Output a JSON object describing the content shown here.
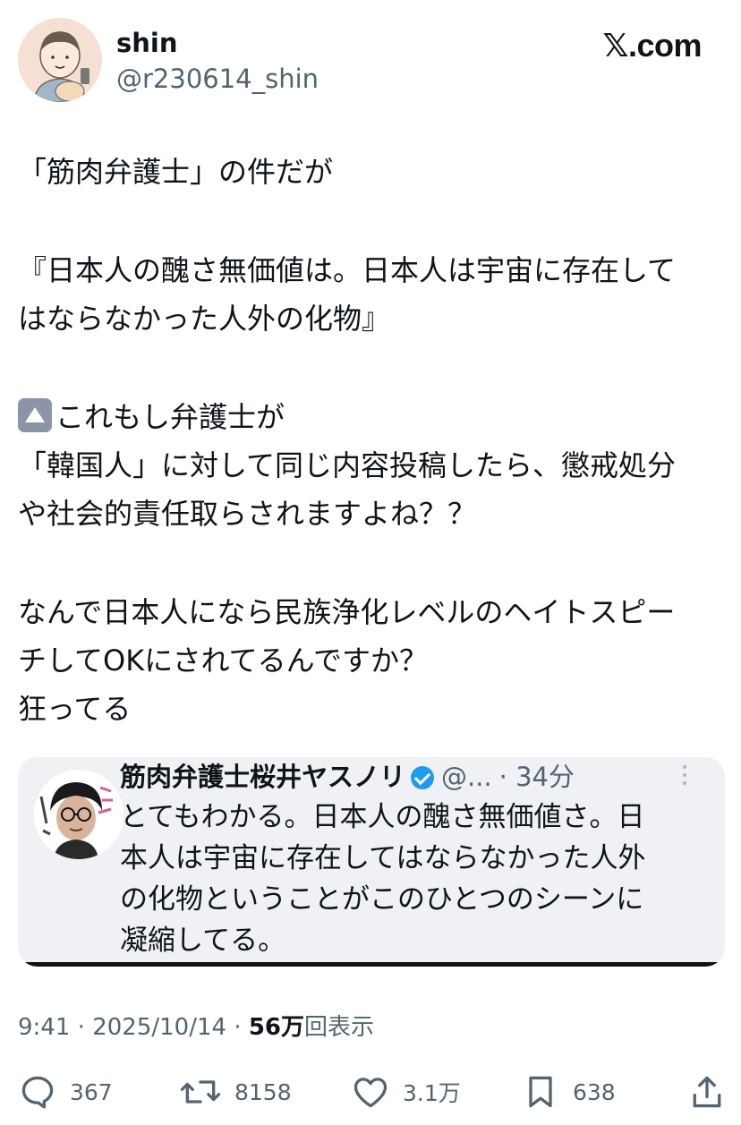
{
  "author": {
    "name": "shin",
    "handle": "@r230614_shin",
    "avatar_icon": "illustrated-avatar-icon"
  },
  "brand": "𝕏.com",
  "post": {
    "lines": {
      "l1": "「筋肉弁護士」の件だが",
      "l2": "『日本人の醜さ無価値は。日本人は宇宙に存在して",
      "l3": "はならなかった人外の化物』",
      "l4": "これもし弁護士が",
      "l5": "「韓国人」に対して同じ内容投稿したら、懲戒処分",
      "l6": "や社会的責任取らされますよね？？",
      "l7": "なんで日本人になら民族浄化レベルのヘイトスピー",
      "l8": "チしてOKにされてるんですか？",
      "l9": "狂ってる"
    },
    "emoji": "up-arrow-emoji-icon"
  },
  "quote": {
    "name": "筋肉弁護士桜井ヤスノリ",
    "handle": "@...",
    "time": "· 34分",
    "lines": {
      "l1": "とてもわかる。日本人の醜さ無価値さ。日",
      "l2": "本人は宇宙に存在してはならなかった人外",
      "l3": "の化物ということがこのひとつのシーンに",
      "l4": "凝縮してる。"
    },
    "avatar_icon": "quoted-user-avatar-icon"
  },
  "meta": {
    "time": "9:41",
    "date": "2025/10/14",
    "views_count": "56万",
    "views_label": "回表示",
    "sep": "·"
  },
  "actions": {
    "replies": "367",
    "reposts": "8158",
    "likes": "3.1万",
    "bookmarks": "638"
  },
  "colors": {
    "text": "#0f1419",
    "secondary": "#536471",
    "verified": "#1d9bf0",
    "quote_bg": "#f0f1f4"
  }
}
